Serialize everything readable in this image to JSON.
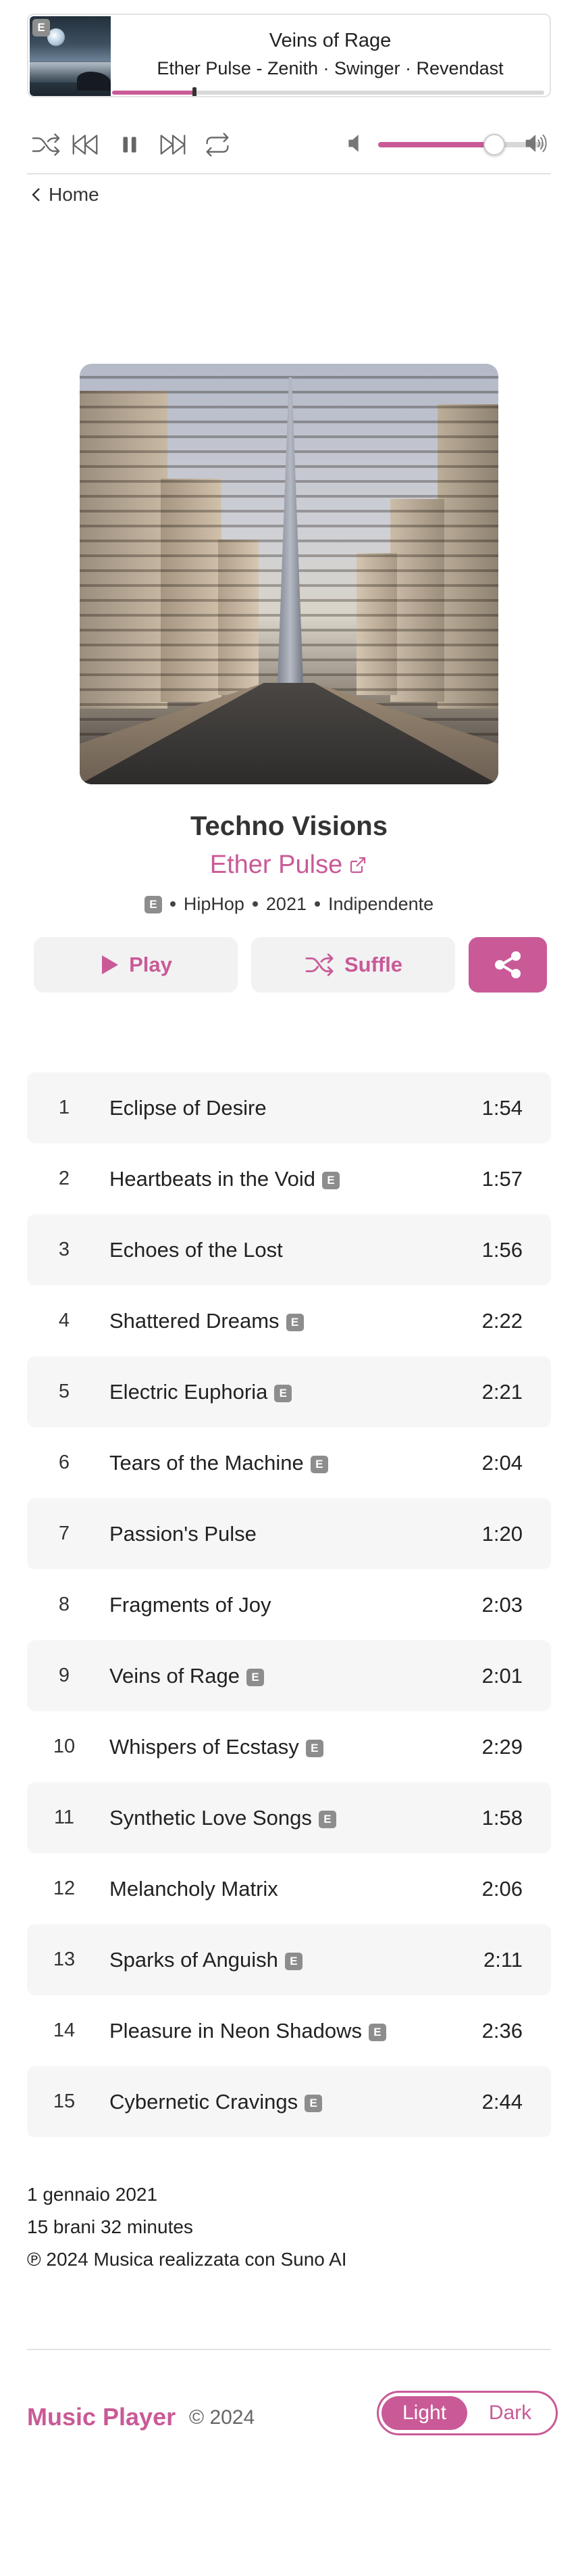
{
  "player": {
    "explicit_badge": "E",
    "track_title": "Veins of Rage",
    "track_artists": "Ether Pulse - Zenith · Swinger · Revendast",
    "progress_fraction": 0.19,
    "volume_fraction": 0.7
  },
  "nav": {
    "home_label": "Home"
  },
  "album": {
    "title": "Techno Visions",
    "artist": "Ether Pulse",
    "explicit_badge": "E",
    "genre": "HipHop",
    "year": "2021",
    "label": "Indipendente",
    "play_label": "Play",
    "shuffle_label": "Suffle"
  },
  "tracks": [
    {
      "num": "1",
      "title": "Eclipse of Desire",
      "explicit": false,
      "duration": "1:54"
    },
    {
      "num": "2",
      "title": "Heartbeats in the Void",
      "explicit": true,
      "duration": "1:57"
    },
    {
      "num": "3",
      "title": "Echoes of the Lost",
      "explicit": false,
      "duration": "1:56"
    },
    {
      "num": "4",
      "title": "Shattered Dreams",
      "explicit": true,
      "duration": "2:22"
    },
    {
      "num": "5",
      "title": "Electric Euphoria",
      "explicit": true,
      "duration": "2:21"
    },
    {
      "num": "6",
      "title": "Tears of the Machine",
      "explicit": true,
      "duration": "2:04"
    },
    {
      "num": "7",
      "title": "Passion's Pulse",
      "explicit": false,
      "duration": "1:20"
    },
    {
      "num": "8",
      "title": "Fragments of Joy",
      "explicit": false,
      "duration": "2:03"
    },
    {
      "num": "9",
      "title": "Veins of Rage",
      "explicit": true,
      "duration": "2:01"
    },
    {
      "num": "10",
      "title": "Whispers of Ecstasy",
      "explicit": true,
      "duration": "2:29"
    },
    {
      "num": "11",
      "title": "Synthetic Love Songs",
      "explicit": true,
      "duration": "1:58"
    },
    {
      "num": "12",
      "title": "Melancholy Matrix",
      "explicit": false,
      "duration": "2:06"
    },
    {
      "num": "13",
      "title": "Sparks of Anguish",
      "explicit": true,
      "duration": "2:11"
    },
    {
      "num": "14",
      "title": "Pleasure in Neon Shadows",
      "explicit": true,
      "duration": "2:36"
    },
    {
      "num": "15",
      "title": "Cybernetic Cravings",
      "explicit": true,
      "duration": "2:44"
    }
  ],
  "info": {
    "release_date": "1 gennaio 2021",
    "summary": "15 brani 32 minutes",
    "copyright": "℗ 2024 Musica realizzata con Suno AI"
  },
  "footer": {
    "brand": "Music Player",
    "copyright": "© 2024",
    "theme_light": "Light",
    "theme_dark": "Dark"
  },
  "colors": {
    "accent": "#c95a97",
    "explicit_badge": "#8d8d8d"
  }
}
